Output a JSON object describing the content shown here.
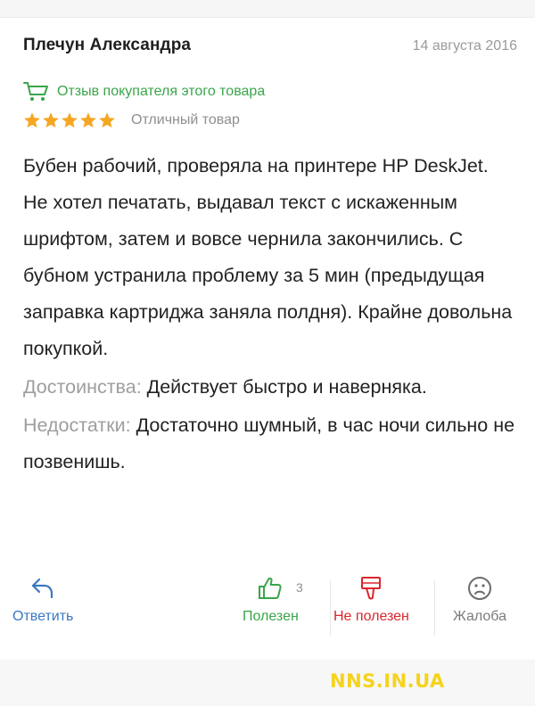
{
  "review": {
    "author": "Плечун Александра",
    "date": "14 августа 2016",
    "verified_text": "Отзыв покупателя этого товара",
    "rating": {
      "stars": 5,
      "max_stars": 5,
      "label": "Отличный товар"
    },
    "text": "Бубен рабочий, проверяла на принтере HP DeskJet. Не хотел печатать, выдавал текст с искаженным шрифтом, затем и вовсе чернила закончились. С бубном устранила проблему за 5 мин (предыдущая заправка картриджа заняла полдня). Крайне довольна покупкой.",
    "advantages_label": "Достоинства:",
    "advantages_text": "Действует быстро и наверняка.",
    "disadvantages_label": "Недостатки:",
    "disadvantages_text": "Достаточно шумный, в час ночи сильно не позвенишь."
  },
  "actions": {
    "reply_label": "Ответить",
    "useful_label": "Полезен",
    "useful_count": "3",
    "not_useful_label": "Не полезен",
    "complain_label": "Жалоба"
  },
  "watermark": "NNS.IN.UA",
  "icons": {
    "verified": "shopping-cart-icon",
    "star": "star-icon",
    "reply": "reply-arrow-icon",
    "useful": "thumbs-up-icon",
    "not_useful": "thumbs-down-icon",
    "complain": "sad-face-icon"
  },
  "colors": {
    "green": "#3aa54a",
    "blue": "#3a78c2",
    "red": "#d9262c",
    "star": "#f5a623",
    "watermark": "#f5d31a"
  }
}
